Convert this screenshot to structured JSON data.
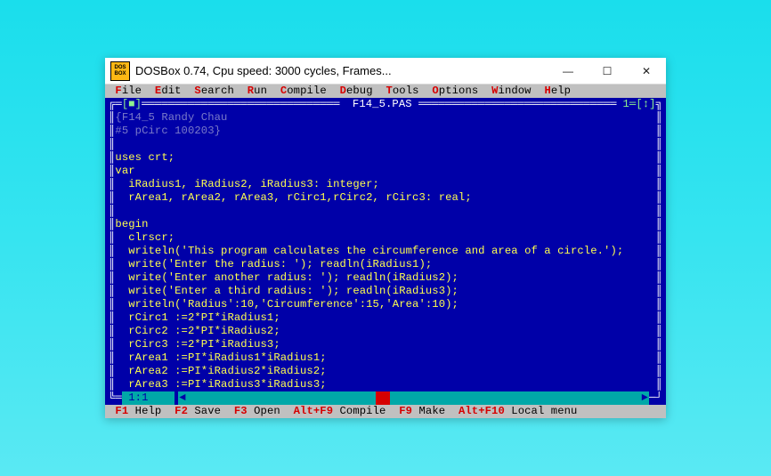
{
  "titlebar": {
    "icon_top": "DOS",
    "icon_bot": "BOX",
    "title": "DOSBox 0.74, Cpu speed:    3000 cycles, Frames...",
    "min": "—",
    "max": "☐",
    "close": "✕"
  },
  "menubar": {
    "items": [
      {
        "hot": "F",
        "rest": "ile"
      },
      {
        "hot": "E",
        "rest": "dit"
      },
      {
        "hot": "S",
        "rest": "earch"
      },
      {
        "hot": "R",
        "rest": "un"
      },
      {
        "hot": "C",
        "rest": "ompile"
      },
      {
        "hot": "D",
        "rest": "ebug"
      },
      {
        "hot": "T",
        "rest": "ools"
      },
      {
        "hot": "O",
        "rest": "ptions"
      },
      {
        "hot": "W",
        "rest": "indow"
      },
      {
        "hot": "H",
        "rest": "elp"
      }
    ]
  },
  "frame": {
    "close_gadget": "[■]",
    "filename": " F14_5.PAS ",
    "num_gadget": "1═[↕]"
  },
  "code": {
    "lines": [
      {
        "cls": "comment",
        "t": "{F14_5 Randy Chau"
      },
      {
        "cls": "comment",
        "t": "#5 pCirc 100203}"
      },
      {
        "cls": "code",
        "t": ""
      },
      {
        "cls": "code",
        "t": "uses crt;"
      },
      {
        "cls": "code",
        "t": "var"
      },
      {
        "cls": "code",
        "t": "  iRadius1, iRadius2, iRadius3: integer;"
      },
      {
        "cls": "code",
        "t": "  rArea1, rArea2, rArea3, rCirc1,rCirc2, rCirc3: real;"
      },
      {
        "cls": "code",
        "t": ""
      },
      {
        "cls": "code",
        "t": "begin"
      },
      {
        "cls": "code",
        "t": "  clrscr;"
      },
      {
        "cls": "code",
        "t": "  writeln('This program calculates the circumference and area of a circle.');"
      },
      {
        "cls": "code",
        "t": "  write('Enter the radius: '); readln(iRadius1);"
      },
      {
        "cls": "code",
        "t": "  write('Enter another radius: '); readln(iRadius2);"
      },
      {
        "cls": "code",
        "t": "  write('Enter a third radius: '); readln(iRadius3);"
      },
      {
        "cls": "code",
        "t": "  writeln('Radius':10,'Circumference':15,'Area':10);"
      },
      {
        "cls": "code",
        "t": "  rCirc1 :=2*PI*iRadius1;"
      },
      {
        "cls": "code",
        "t": "  rCirc2 :=2*PI*iRadius2;"
      },
      {
        "cls": "code",
        "t": "  rCirc3 :=2*PI*iRadius3;"
      },
      {
        "cls": "code",
        "t": "  rArea1 :=PI*iRadius1*iRadius1;"
      },
      {
        "cls": "code",
        "t": "  rArea2 :=PI*iRadius2*iRadius2;"
      },
      {
        "cls": "code",
        "t": "  rArea3 :=PI*iRadius3*iRadius3;"
      }
    ]
  },
  "status": {
    "pos": " 1:1    ",
    "arrow_l": "◄",
    "arrow_r": "►"
  },
  "fnbar": {
    "items": [
      {
        "hot": "F1",
        "rest": " Help"
      },
      {
        "hot": "F2",
        "rest": " Save"
      },
      {
        "hot": "F3",
        "rest": " Open"
      },
      {
        "hot": "Alt+F9",
        "rest": " Compile"
      },
      {
        "hot": "F9",
        "rest": " Make"
      },
      {
        "hot": "Alt+F10",
        "rest": " Local menu"
      }
    ]
  }
}
